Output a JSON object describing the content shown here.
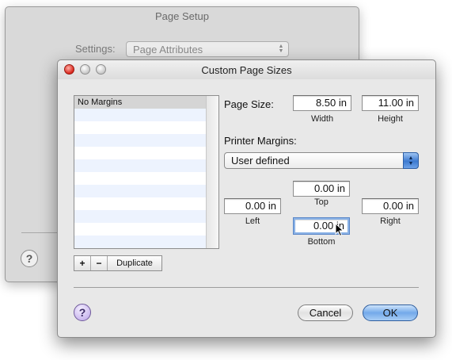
{
  "background_window": {
    "title": "Page Setup",
    "settings_label": "Settings:",
    "settings_value": "Page Attributes",
    "help": "?"
  },
  "dialog": {
    "title": "Custom Page Sizes",
    "list": {
      "items": [
        "No Margins"
      ],
      "selected_index": 0
    },
    "list_buttons": {
      "add": "+",
      "remove": "−",
      "duplicate": "Duplicate"
    },
    "page_size": {
      "label": "Page Size:",
      "width": "8.50 in",
      "width_label": "Width",
      "height": "11.00 in",
      "height_label": "Height"
    },
    "printer_margins": {
      "label": "Printer Margins:",
      "selected": "User defined",
      "top": "0.00 in",
      "top_label": "Top",
      "left": "0.00 in",
      "left_label": "Left",
      "right": "0.00 in",
      "right_label": "Right",
      "bottom": "0.00 in",
      "bottom_label": "Bottom"
    },
    "help": "?",
    "cancel": "Cancel",
    "ok": "OK"
  }
}
